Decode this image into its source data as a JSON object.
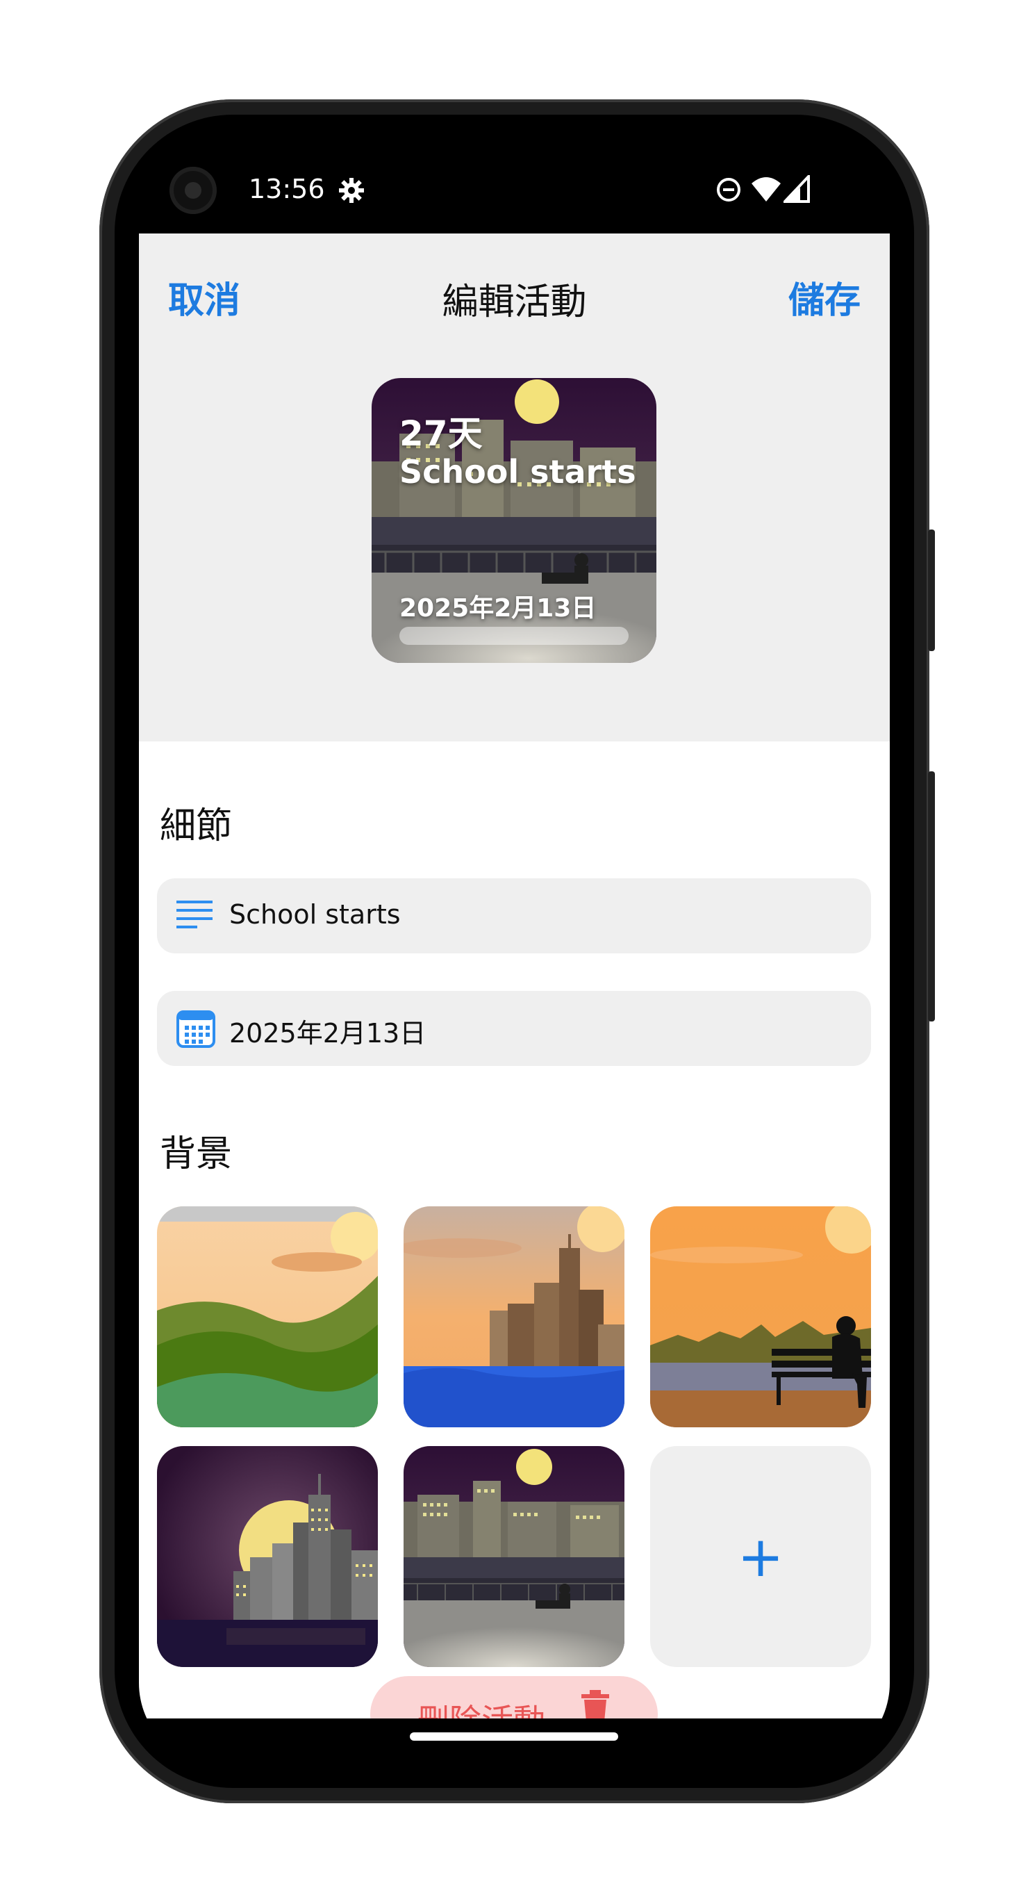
{
  "status_bar": {
    "time": "13:56"
  },
  "header": {
    "cancel_label": "取消",
    "title": "編輯活動",
    "save_label": "儲存"
  },
  "preview": {
    "days_left": "27天",
    "event_title": "School starts",
    "event_date": "2025年2月13日",
    "progress": 0
  },
  "details": {
    "section_title": "細節",
    "title_field_value": "School starts",
    "date_field_value": "2025年2月13日"
  },
  "backgrounds": {
    "section_title": "背景",
    "items": [
      {
        "name": "green-hills"
      },
      {
        "name": "city-sea-sunset"
      },
      {
        "name": "bench-sunset"
      },
      {
        "name": "city-moon-purple"
      },
      {
        "name": "city-night-bench"
      }
    ],
    "add_label": "+"
  },
  "delete_label": "刪除活動",
  "colors": {
    "accent": "#1d7be0",
    "danger": "#e85555",
    "danger_bg": "#fbd5d5",
    "field_bg": "#efefef"
  }
}
